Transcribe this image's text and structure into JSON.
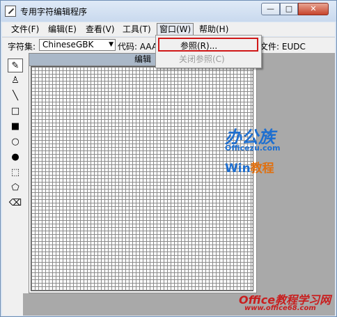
{
  "window": {
    "title": "专用字符编辑程序",
    "controls": {
      "minimize": "—",
      "maximize": "□",
      "close": "✕"
    }
  },
  "menubar": {
    "items": [
      {
        "label": "文件(F)"
      },
      {
        "label": "编辑(E)"
      },
      {
        "label": "查看(V)"
      },
      {
        "label": "工具(T)"
      },
      {
        "label": "窗口(W)"
      },
      {
        "label": "帮助(H)"
      }
    ]
  },
  "toolbar": {
    "charset_label": "字符集:",
    "charset_value": "ChineseGBK",
    "code_label": "代码: AAA",
    "file_label": "文件: EUDC"
  },
  "editor": {
    "title": "编辑"
  },
  "tools": [
    {
      "icon": "pencil-icon",
      "glyph": "✎",
      "selected": true
    },
    {
      "icon": "brush-icon",
      "glyph": "♙"
    },
    {
      "icon": "line-icon",
      "glyph": "╲"
    },
    {
      "icon": "hollow-rectangle-icon",
      "glyph": "□"
    },
    {
      "icon": "filled-rectangle-icon",
      "glyph": "■"
    },
    {
      "icon": "hollow-ellipse-icon",
      "glyph": "○"
    },
    {
      "icon": "filled-ellipse-icon",
      "glyph": "●"
    },
    {
      "icon": "rect-select-icon",
      "glyph": "⬚"
    },
    {
      "icon": "freeform-select-icon",
      "glyph": "⬠"
    },
    {
      "icon": "eraser-icon",
      "glyph": "⌫"
    }
  ],
  "window_menu": {
    "items": [
      {
        "label": "参照(R)..."
      },
      {
        "label": "关闭参照(C)",
        "disabled": true
      }
    ]
  },
  "watermarks": {
    "brand_cn": "办公族",
    "brand_url": "Officezu.com",
    "win_label": "Win",
    "tutorial_label": "教程",
    "footer_cn": "Office教程学习网",
    "footer_url": "www.office68.com"
  }
}
